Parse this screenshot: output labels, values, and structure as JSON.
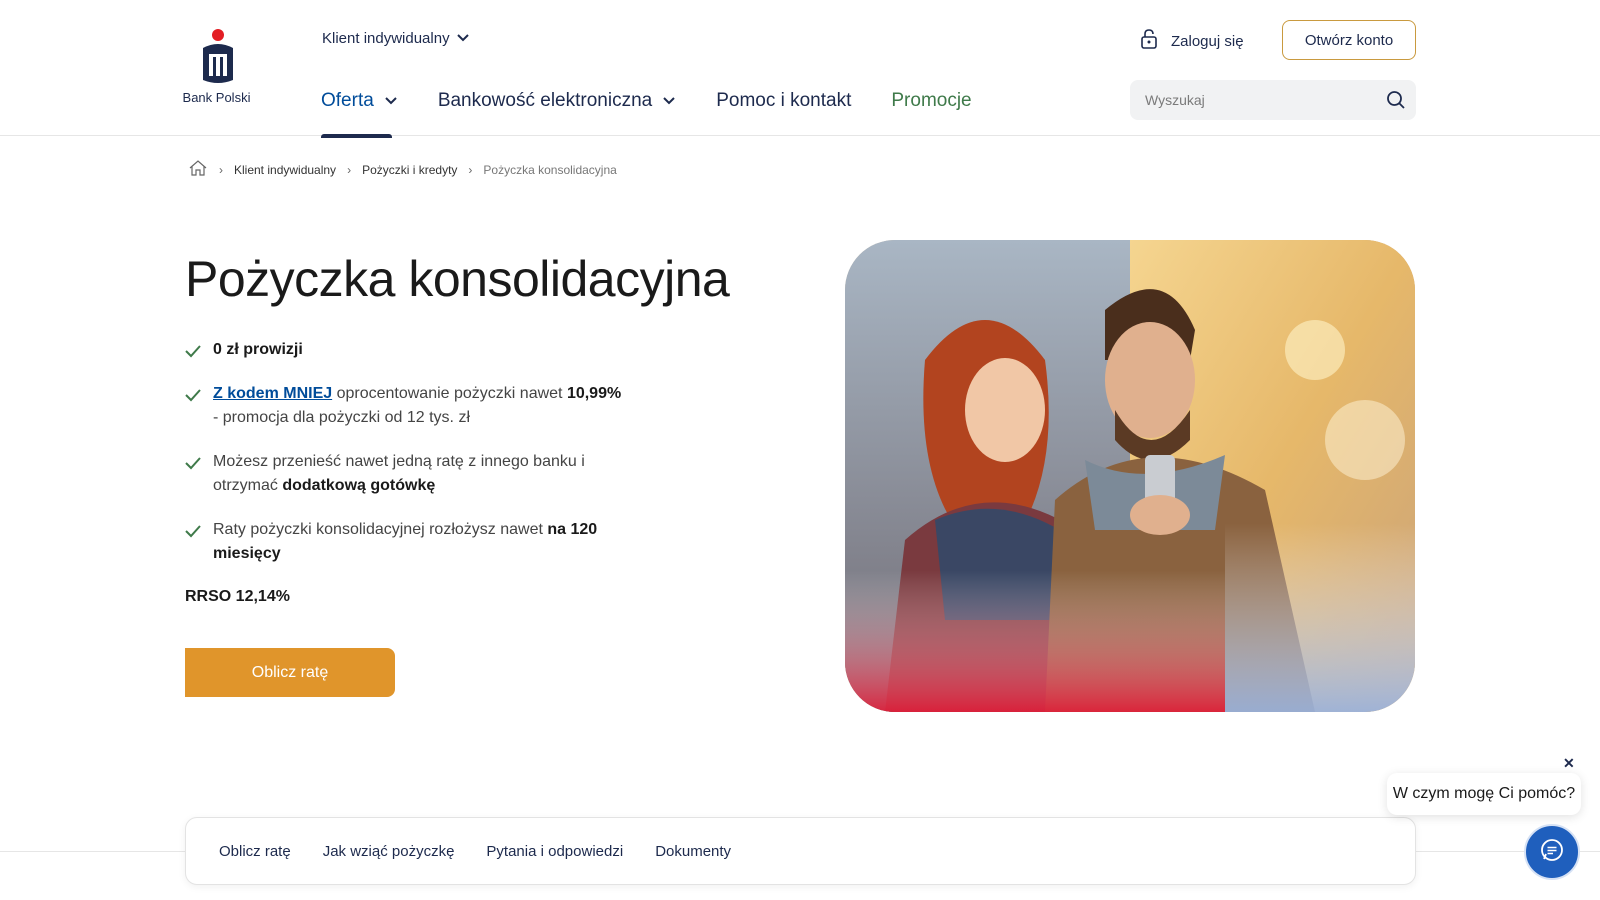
{
  "header": {
    "logo_text": "Bank Polski",
    "segment_label": "Klient indywidualny",
    "nav": [
      {
        "label": "Oferta"
      },
      {
        "label": "Bankowość elektroniczna"
      },
      {
        "label": "Pomoc i kontakt"
      },
      {
        "label": "Promocje"
      }
    ],
    "login_label": "Zaloguj się",
    "open_account_label": "Otwórz konto",
    "search_placeholder": "Wyszukaj"
  },
  "breadcrumb": {
    "items": [
      "Klient indywidualny",
      "Pożyczki i kredyty"
    ],
    "current": "Pożyczka konsolidacyjna"
  },
  "hero": {
    "title": "Pożyczka konsolidacyjna",
    "benefits": [
      {
        "bold": "0 zł prowizji"
      },
      {
        "link": "Z kodem MNIEJ",
        "text": " oprocentowanie pożyczki nawet ",
        "bold": "10,99%",
        "text2": " - promocja dla pożyczki od 12 tys. zł"
      },
      {
        "text": "Możesz przenieść nawet jedną ratę z innego banku i otrzymać ",
        "bold": "dodatkową gotówkę"
      },
      {
        "text": "Raty pożyczki konsolidacyjnej rozłożysz nawet ",
        "bold": "na 120 miesięcy"
      }
    ],
    "rrso": "RRSO 12,14%",
    "cta_label": "Oblicz ratę"
  },
  "tabs": [
    "Oblicz ratę",
    "Jak wziąć pożyczkę",
    "Pytania i odpowiedzi",
    "Dokumenty"
  ],
  "chat": {
    "prompt": "W czym mogę Ci pomóc?",
    "close": "✕"
  },
  "colors": {
    "brand_navy": "#1d2a4d",
    "accent_gold": "#e0952b",
    "link_blue": "#004c9a",
    "promo_green": "#3f7a4a",
    "check_green": "#3f7a4a",
    "chat_blue": "#1f5fbd"
  },
  "icons": [
    "pko-logo",
    "chevron-down-icon",
    "lock-icon",
    "search-icon",
    "home-icon",
    "check-icon",
    "close-icon",
    "chat-icon"
  ]
}
